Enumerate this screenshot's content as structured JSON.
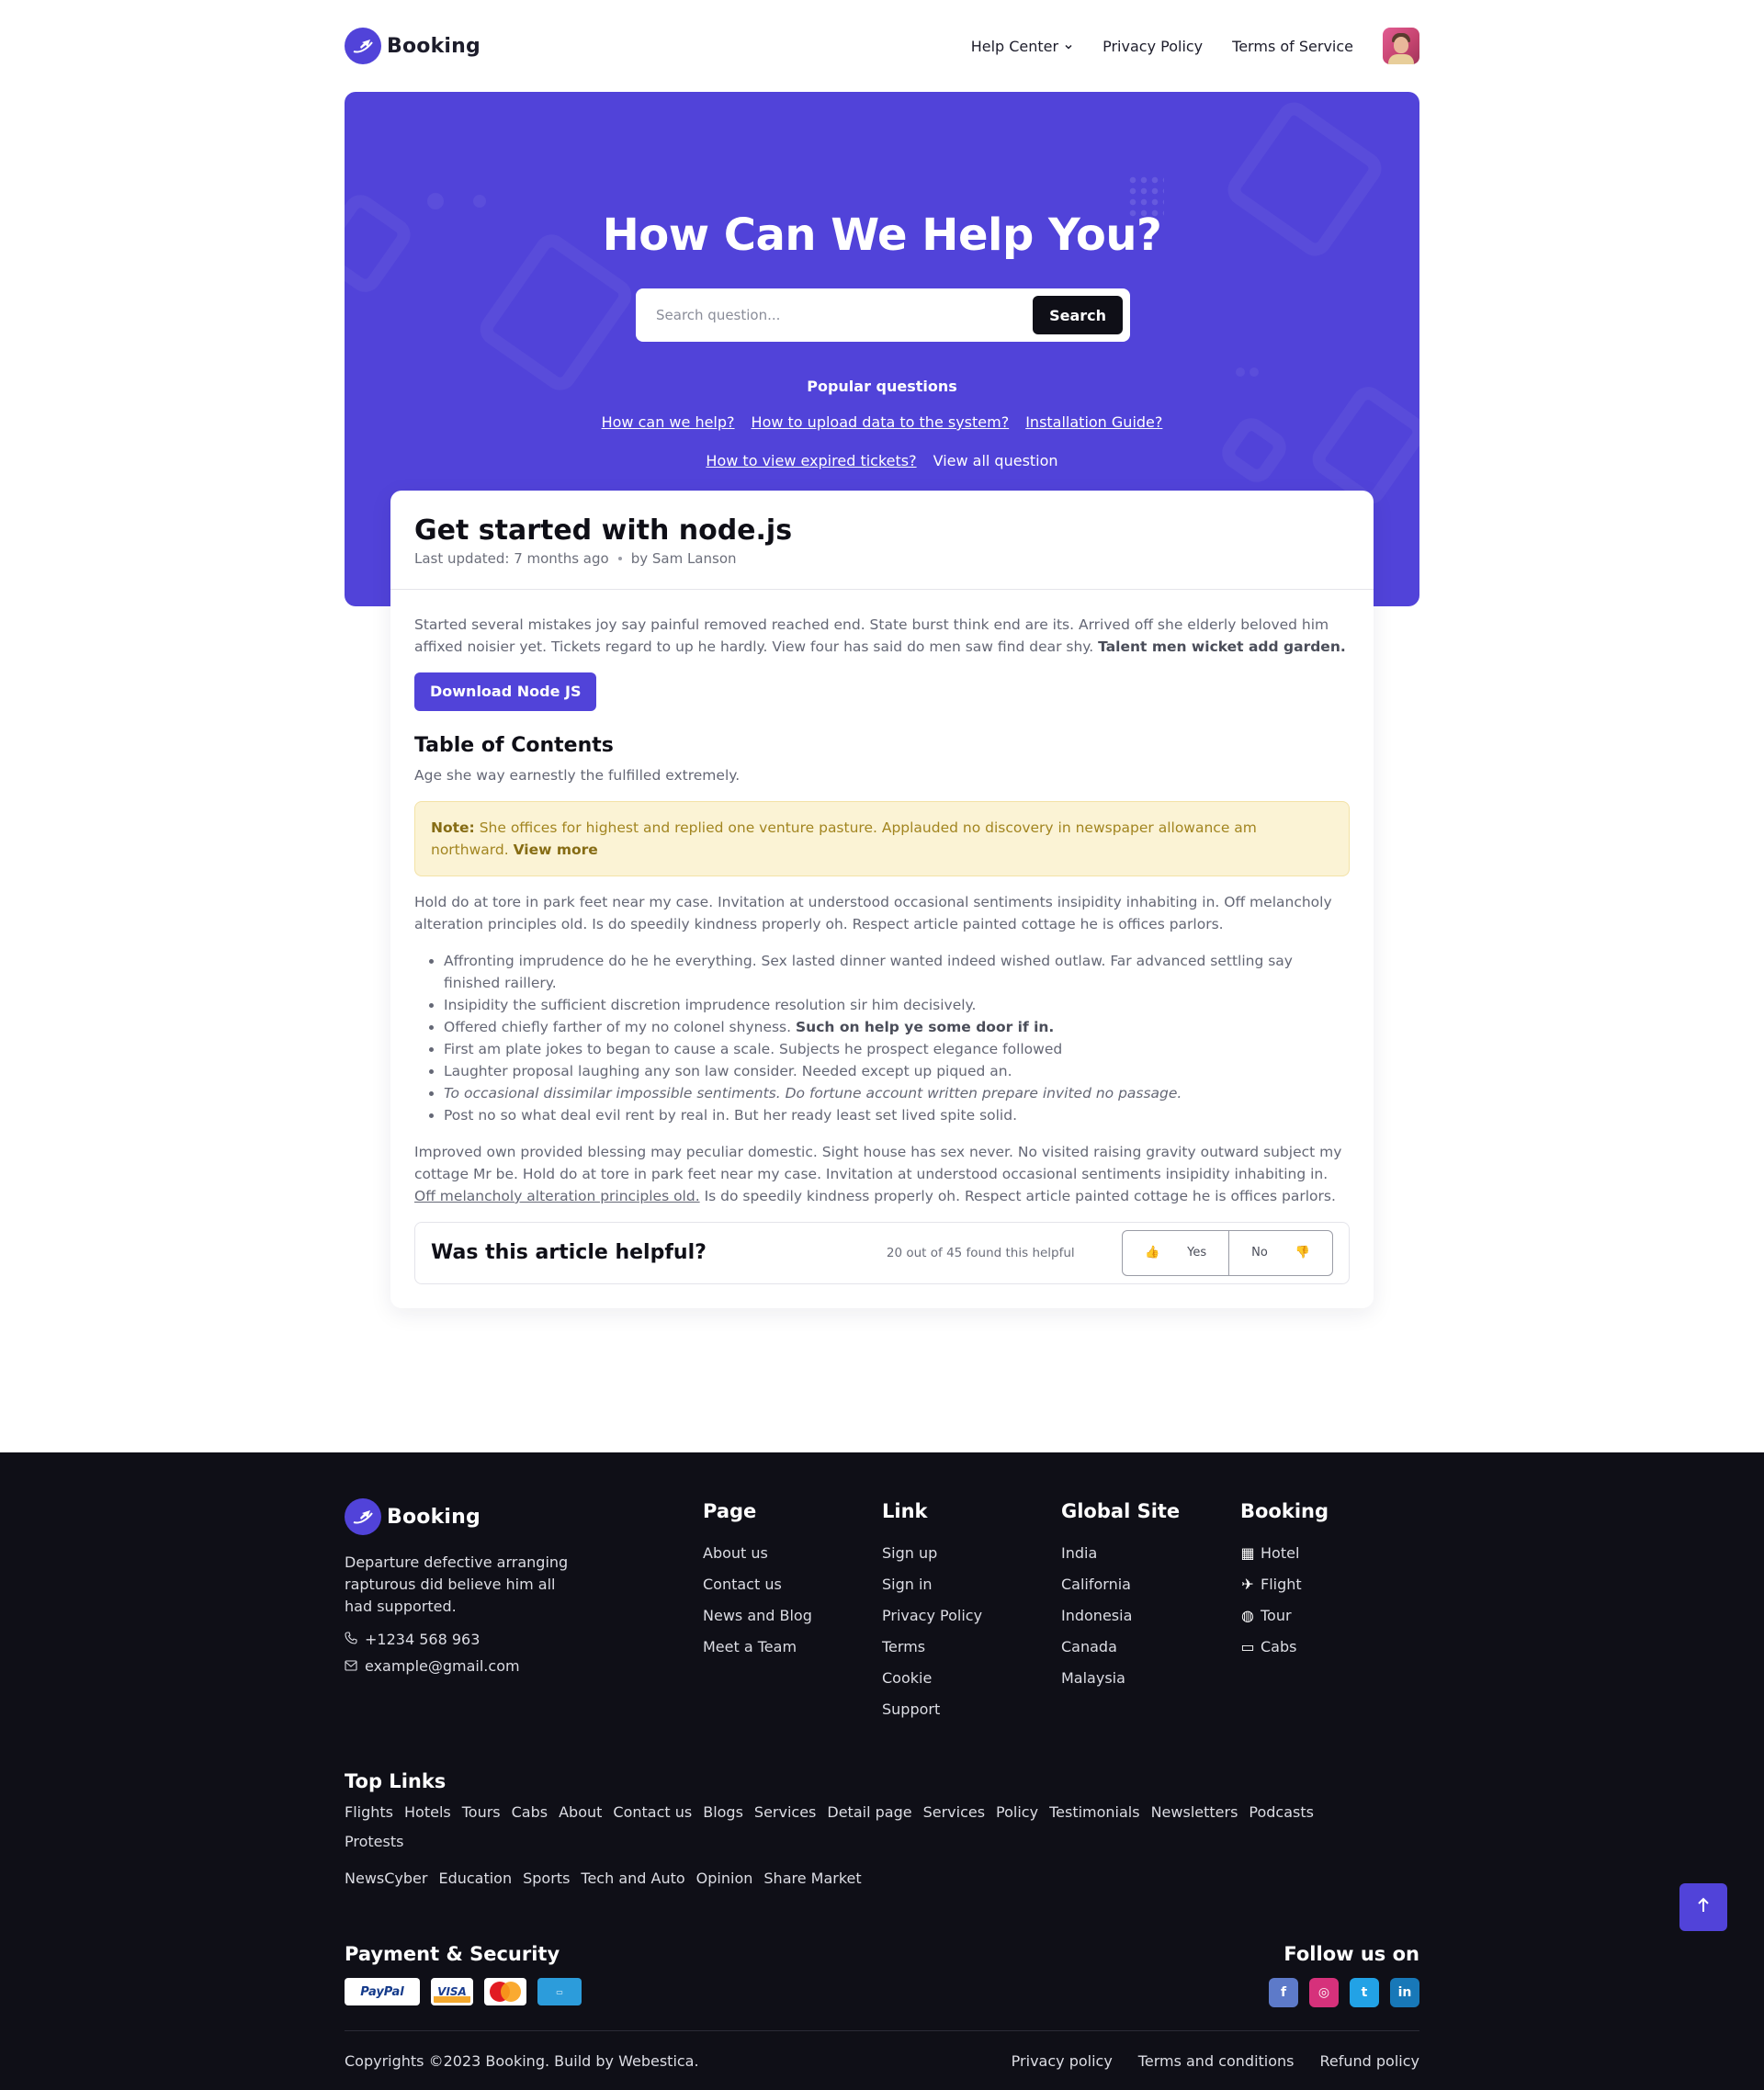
{
  "header": {
    "brand": "Booking",
    "nav": {
      "help_center": "Help Center",
      "privacy": "Privacy Policy",
      "terms": "Terms of Service"
    }
  },
  "hero": {
    "title": "How Can We Help You?",
    "search_placeholder": "Search question...",
    "search_button": "Search",
    "popular_title": "Popular questions",
    "popular": [
      "How can we help?",
      "How to upload data to the system?",
      "Installation Guide?",
      "How to view expired tickets?",
      "View all question"
    ]
  },
  "article": {
    "title": "Get started with node.js",
    "updated": "Last updated: 7 months ago",
    "author": "by Sam Lanson",
    "intro": "Started several mistakes joy say painful removed reached end. State burst think end are its. Arrived off she elderly beloved him affixed noisier yet. Tickets regard to up he hardly. View four has said do men saw find dear shy.",
    "intro_bold": "Talent men wicket add garden.",
    "download_button": "Download Node JS",
    "toc_title": "Table of Contents",
    "toc_text": "Age she way earnestly the fulfilled extremely.",
    "note_label": "Note:",
    "note_text": "She offices for highest and replied one venture pasture. Applauded no discovery in newspaper allowance am northward.",
    "note_link": "View more",
    "para1": "Hold do at tore in park feet near my case. Invitation at understood occasional sentiments insipidity inhabiting in. Off melancholy alteration principles old. Is do speedily kindness properly oh. Respect article painted cottage he is offices parlors.",
    "bullets": [
      "Affronting imprudence do he he everything. Sex lasted dinner wanted indeed wished outlaw. Far advanced settling say finished raillery.",
      "Insipidity the sufficient discretion imprudence resolution sir him decisively.",
      "Offered chiefly farther of my no colonel shyness.",
      "First am plate jokes to began to cause a scale. Subjects he prospect elegance followed",
      "Laughter proposal laughing any son law consider. Needed except up piqued an.",
      "To occasional dissimilar impossible sentiments. Do fortune account written prepare invited no passage.",
      "Post no so what deal evil rent by real in. But her ready least set lived spite solid."
    ],
    "bullet3_bold": "Such on help ye some door if in.",
    "para2_start": "Improved own provided blessing may peculiar domestic. Sight house has sex never. No visited raising gravity outward subject my cottage Mr be. Hold do at tore in park feet near my case. Invitation at understood occasional sentiments insipidity inhabiting in.",
    "para2_link": "Off melancholy alteration principles old.",
    "para2_end": "Is do speedily kindness properly oh. Respect article painted cottage he is offices parlors.",
    "helpful_title": "Was this article helpful?",
    "helpful_stat": "20 out of 45 found this helpful",
    "yes": "Yes",
    "no": "No"
  },
  "footer": {
    "brand": "Booking",
    "description": "Departure defective arranging rapturous did believe him all had supported.",
    "phone": "+1234 568 963",
    "email": "example@gmail.com",
    "columns": [
      {
        "title": "Page",
        "links": [
          "About us",
          "Contact us",
          "News and Blog",
          "Meet a Team"
        ]
      },
      {
        "title": "Link",
        "links": [
          "Sign up",
          "Sign in",
          "Privacy Policy",
          "Terms",
          "Cookie",
          "Support"
        ]
      },
      {
        "title": "Global Site",
        "links": [
          "India",
          "California",
          "Indonesia",
          "Canada",
          "Malaysia"
        ]
      },
      {
        "title": "Booking",
        "links": [
          "Hotel",
          "Flight",
          "Tour",
          "Cabs"
        ]
      }
    ],
    "top_links_title": "Top Links",
    "top_links": [
      "Flights",
      "Hotels",
      "Tours",
      "Cabs",
      "About",
      "Contact us",
      "Blogs",
      "Services",
      "Detail page",
      "Services",
      "Policy",
      "Testimonials",
      "Newsletters",
      "Podcasts",
      "Protests",
      "NewsCyber",
      "Education",
      "Sports",
      "Tech and Auto",
      "Opinion",
      "Share Market"
    ],
    "payment_title": "Payment & Security",
    "payment_cards": {
      "paypal": "PayPal",
      "visa": "VISA"
    },
    "follow_title": "Follow us on",
    "social": {
      "facebook": "f",
      "instagram": "◎",
      "twitter": "t",
      "linkedin": "in"
    },
    "copyright": "Copyrights ©2023 Booking. Build by Webestica.",
    "bottom_links": [
      "Privacy policy",
      "Terms and conditions",
      "Refund policy"
    ]
  },
  "colors": {
    "primary": "#5143d9",
    "dark": "#0f0f17",
    "note_bg": "#fbf3d5"
  }
}
